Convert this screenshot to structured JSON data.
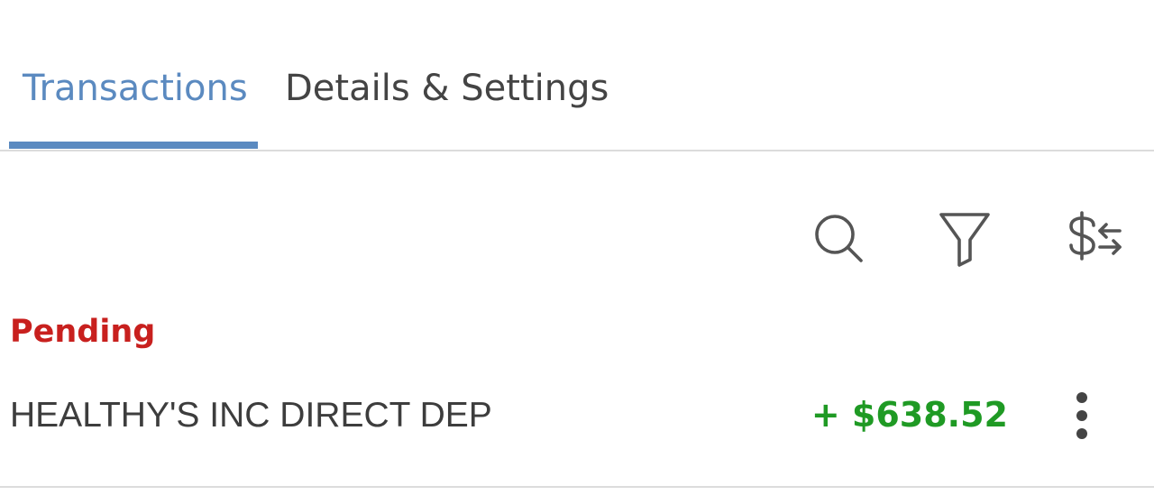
{
  "colors": {
    "accent": "#5b8ac0",
    "pending": "#c8201e",
    "positive": "#1f9a24",
    "icon": "#555555"
  },
  "tabs": [
    {
      "label": "Transactions",
      "active": true
    },
    {
      "label": "Details & Settings",
      "active": false
    }
  ],
  "toolbar": {
    "icons": [
      "search-icon",
      "filter-icon",
      "dollar-swap-icon"
    ]
  },
  "section": {
    "label": "Pending"
  },
  "transactions": [
    {
      "description": "HEALTHY'S INC DIRECT DEP",
      "amount": "+ $638.52",
      "menu_icon": "more-vertical-icon"
    }
  ]
}
